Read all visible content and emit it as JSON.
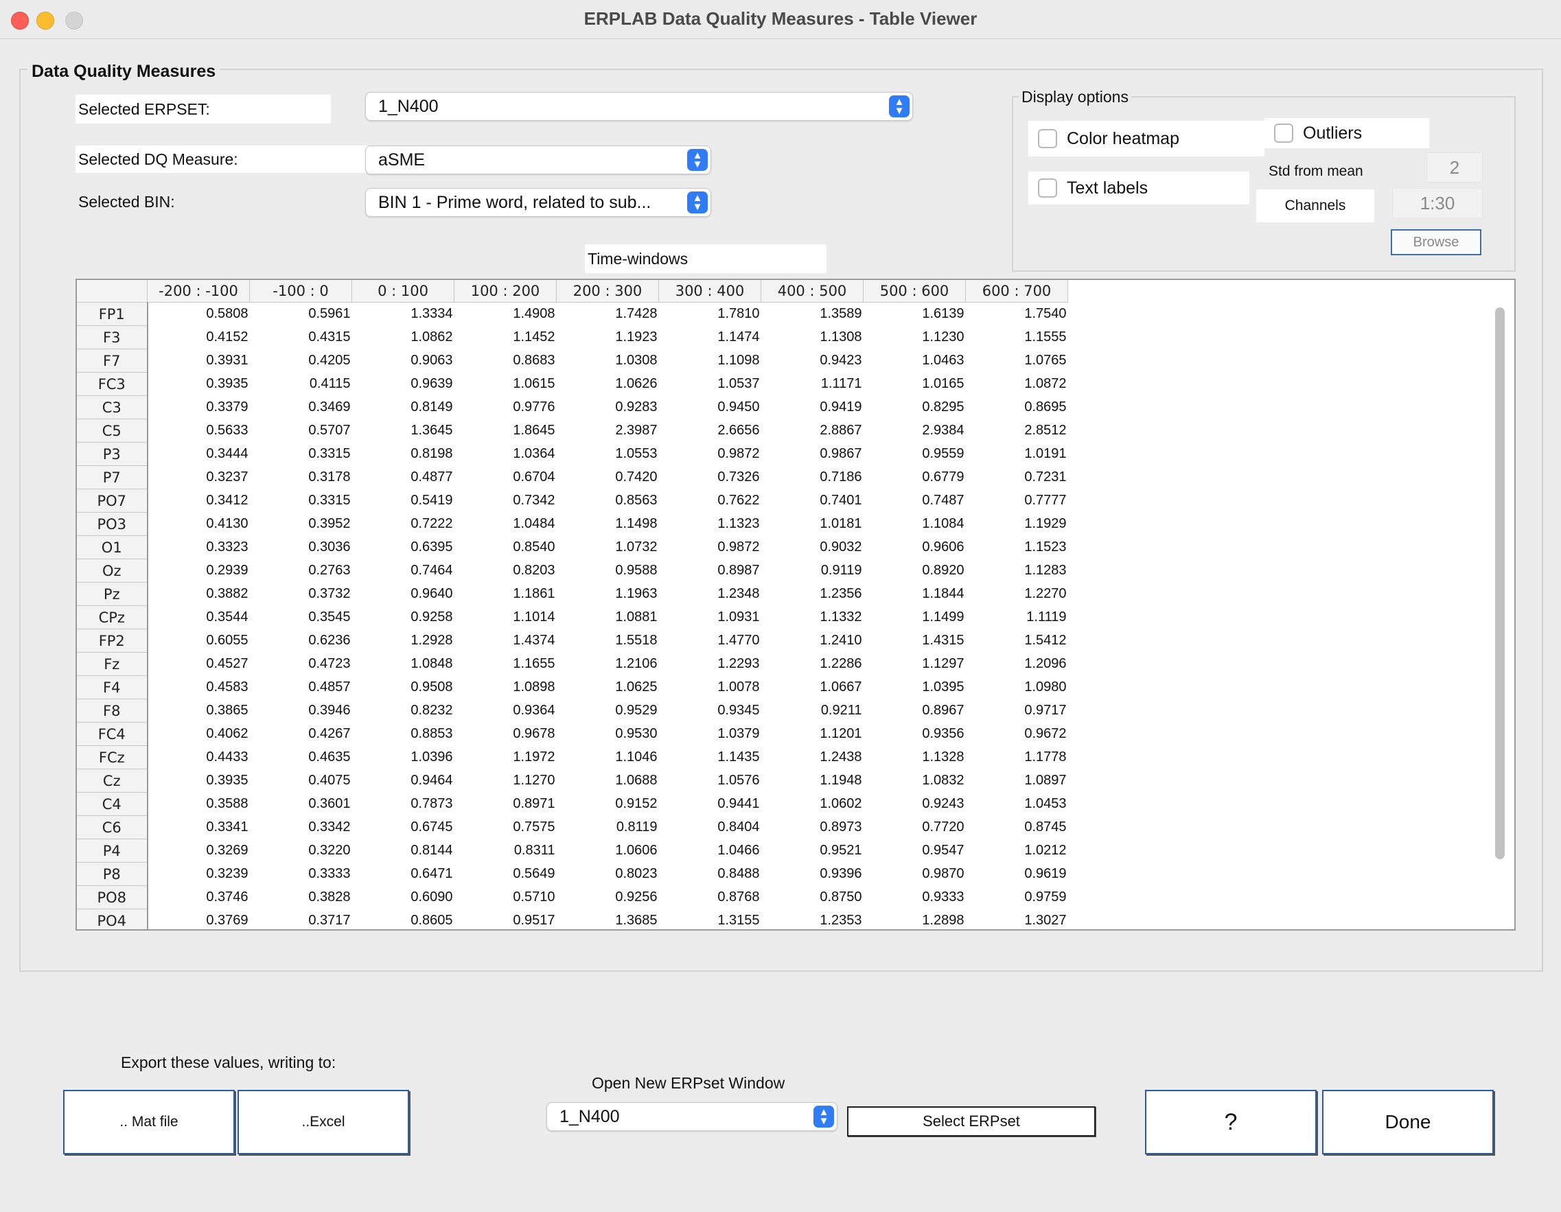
{
  "window": {
    "title": "ERPLAB Data Quality Measures - Table Viewer"
  },
  "panel": {
    "title": "Data Quality Measures"
  },
  "erpset": {
    "label": "Selected ERPSET:",
    "value": "1_N400"
  },
  "dq_measure": {
    "label": "Selected DQ Measure:",
    "value": "aSME"
  },
  "bin": {
    "label": "Selected BIN:",
    "value": "BIN 1 - Prime word, related to sub..."
  },
  "display_options": {
    "title": "Display options",
    "color_heatmap": "Color heatmap",
    "text_labels": "Text labels",
    "outliers": "Outliers",
    "std_from_mean_label": "Std from mean",
    "std_from_mean_value": "2",
    "channels_label": "Channels",
    "channels_value": "1:30",
    "browse": "Browse"
  },
  "table": {
    "caption": "Time-windows",
    "columns": [
      "-200 : -100",
      "-100 : 0",
      "0 : 100",
      "100 : 200",
      "200 : 300",
      "300 : 400",
      "400 : 500",
      "500 : 600",
      "600 : 700"
    ],
    "rows": [
      {
        "ch": "FP1",
        "v": [
          "0.5808",
          "0.5961",
          "1.3334",
          "1.4908",
          "1.7428",
          "1.7810",
          "1.3589",
          "1.6139",
          "1.7540"
        ]
      },
      {
        "ch": "F3",
        "v": [
          "0.4152",
          "0.4315",
          "1.0862",
          "1.1452",
          "1.1923",
          "1.1474",
          "1.1308",
          "1.1230",
          "1.1555"
        ]
      },
      {
        "ch": "F7",
        "v": [
          "0.3931",
          "0.4205",
          "0.9063",
          "0.8683",
          "1.0308",
          "1.1098",
          "0.9423",
          "1.0463",
          "1.0765"
        ]
      },
      {
        "ch": "FC3",
        "v": [
          "0.3935",
          "0.4115",
          "0.9639",
          "1.0615",
          "1.0626",
          "1.0537",
          "1.1171",
          "1.0165",
          "1.0872"
        ]
      },
      {
        "ch": "C3",
        "v": [
          "0.3379",
          "0.3469",
          "0.8149",
          "0.9776",
          "0.9283",
          "0.9450",
          "0.9419",
          "0.8295",
          "0.8695"
        ]
      },
      {
        "ch": "C5",
        "v": [
          "0.5633",
          "0.5707",
          "1.3645",
          "1.8645",
          "2.3987",
          "2.6656",
          "2.8867",
          "2.9384",
          "2.8512"
        ]
      },
      {
        "ch": "P3",
        "v": [
          "0.3444",
          "0.3315",
          "0.8198",
          "1.0364",
          "1.0553",
          "0.9872",
          "0.9867",
          "0.9559",
          "1.0191"
        ]
      },
      {
        "ch": "P7",
        "v": [
          "0.3237",
          "0.3178",
          "0.4877",
          "0.6704",
          "0.7420",
          "0.7326",
          "0.7186",
          "0.6779",
          "0.7231"
        ]
      },
      {
        "ch": "PO7",
        "v": [
          "0.3412",
          "0.3315",
          "0.5419",
          "0.7342",
          "0.8563",
          "0.7622",
          "0.7401",
          "0.7487",
          "0.7777"
        ]
      },
      {
        "ch": "PO3",
        "v": [
          "0.4130",
          "0.3952",
          "0.7222",
          "1.0484",
          "1.1498",
          "1.1323",
          "1.0181",
          "1.1084",
          "1.1929"
        ]
      },
      {
        "ch": "O1",
        "v": [
          "0.3323",
          "0.3036",
          "0.6395",
          "0.8540",
          "1.0732",
          "0.9872",
          "0.9032",
          "0.9606",
          "1.1523"
        ]
      },
      {
        "ch": "Oz",
        "v": [
          "0.2939",
          "0.2763",
          "0.7464",
          "0.8203",
          "0.9588",
          "0.8987",
          "0.9119",
          "0.8920",
          "1.1283"
        ]
      },
      {
        "ch": "Pz",
        "v": [
          "0.3882",
          "0.3732",
          "0.9640",
          "1.1861",
          "1.1963",
          "1.2348",
          "1.2356",
          "1.1844",
          "1.2270"
        ]
      },
      {
        "ch": "CPz",
        "v": [
          "0.3544",
          "0.3545",
          "0.9258",
          "1.1014",
          "1.0881",
          "1.0931",
          "1.1332",
          "1.1499",
          "1.1119"
        ]
      },
      {
        "ch": "FP2",
        "v": [
          "0.6055",
          "0.6236",
          "1.2928",
          "1.4374",
          "1.5518",
          "1.4770",
          "1.2410",
          "1.4315",
          "1.5412"
        ]
      },
      {
        "ch": "Fz",
        "v": [
          "0.4527",
          "0.4723",
          "1.0848",
          "1.1655",
          "1.2106",
          "1.2293",
          "1.2286",
          "1.1297",
          "1.2096"
        ]
      },
      {
        "ch": "F4",
        "v": [
          "0.4583",
          "0.4857",
          "0.9508",
          "1.0898",
          "1.0625",
          "1.0078",
          "1.0667",
          "1.0395",
          "1.0980"
        ]
      },
      {
        "ch": "F8",
        "v": [
          "0.3865",
          "0.3946",
          "0.8232",
          "0.9364",
          "0.9529",
          "0.9345",
          "0.9211",
          "0.8967",
          "0.9717"
        ]
      },
      {
        "ch": "FC4",
        "v": [
          "0.4062",
          "0.4267",
          "0.8853",
          "0.9678",
          "0.9530",
          "1.0379",
          "1.1201",
          "0.9356",
          "0.9672"
        ]
      },
      {
        "ch": "FCz",
        "v": [
          "0.4433",
          "0.4635",
          "1.0396",
          "1.1972",
          "1.1046",
          "1.1435",
          "1.2438",
          "1.1328",
          "1.1778"
        ]
      },
      {
        "ch": "Cz",
        "v": [
          "0.3935",
          "0.4075",
          "0.9464",
          "1.1270",
          "1.0688",
          "1.0576",
          "1.1948",
          "1.0832",
          "1.0897"
        ]
      },
      {
        "ch": "C4",
        "v": [
          "0.3588",
          "0.3601",
          "0.7873",
          "0.8971",
          "0.9152",
          "0.9441",
          "1.0602",
          "0.9243",
          "1.0453"
        ]
      },
      {
        "ch": "C6",
        "v": [
          "0.3341",
          "0.3342",
          "0.6745",
          "0.7575",
          "0.8119",
          "0.8404",
          "0.8973",
          "0.7720",
          "0.8745"
        ]
      },
      {
        "ch": "P4",
        "v": [
          "0.3269",
          "0.3220",
          "0.8144",
          "0.8311",
          "1.0606",
          "1.0466",
          "0.9521",
          "0.9547",
          "1.0212"
        ]
      },
      {
        "ch": "P8",
        "v": [
          "0.3239",
          "0.3333",
          "0.6471",
          "0.5649",
          "0.8023",
          "0.8488",
          "0.9396",
          "0.9870",
          "0.9619"
        ]
      },
      {
        "ch": "PO8",
        "v": [
          "0.3746",
          "0.3828",
          "0.6090",
          "0.5710",
          "0.9256",
          "0.8768",
          "0.8750",
          "0.9333",
          "0.9759"
        ]
      },
      {
        "ch": "PO4",
        "v": [
          "0.3769",
          "0.3717",
          "0.8605",
          "0.9517",
          "1.3685",
          "1.3155",
          "1.2353",
          "1.2898",
          "1.3027"
        ]
      }
    ]
  },
  "export": {
    "label": "Export these values, writing to:",
    "mat": ".. Mat file",
    "excel": "..Excel"
  },
  "open_new": {
    "label": "Open New ERPset Window",
    "value": "1_N400",
    "select": "Select ERPset"
  },
  "buttons": {
    "help": "?",
    "done": "Done"
  }
}
